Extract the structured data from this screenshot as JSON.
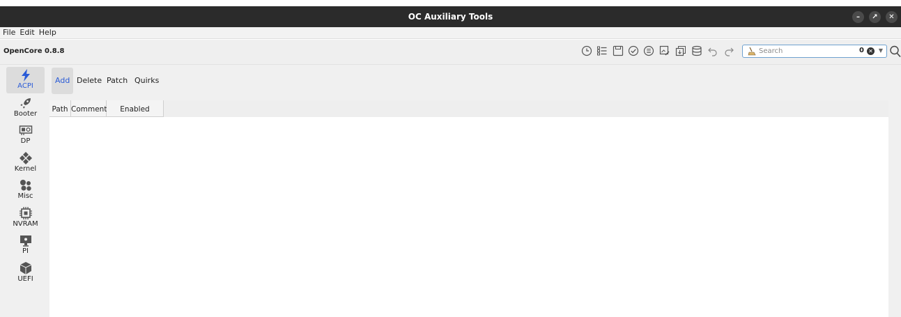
{
  "window": {
    "title": "OC Auxiliary Tools",
    "min_glyph": "–",
    "max_glyph": "↗",
    "close_glyph": "✕"
  },
  "menu": {
    "items": [
      "File",
      "Edit",
      "Help"
    ]
  },
  "toolbar": {
    "version": "OpenCore 0.8.8",
    "icons": [
      "clock-icon",
      "list-icon",
      "save-icon",
      "check-circle-icon",
      "list-circle-icon",
      "image-edit-icon",
      "import-icon",
      "database-icon",
      "undo-icon",
      "redo-icon"
    ],
    "search": {
      "placeholder": "Search",
      "count": "0",
      "clear_glyph": "✕",
      "dropdown_glyph": "▼"
    }
  },
  "sidebar": {
    "items": [
      {
        "label": "ACPI",
        "icon": "lightning-icon",
        "active": true
      },
      {
        "label": "Booter",
        "icon": "rocket-icon"
      },
      {
        "label": "DP",
        "icon": "graphics-card-icon"
      },
      {
        "label": "Kernel",
        "icon": "cubes-icon"
      },
      {
        "label": "Misc",
        "icon": "hexagons-icon"
      },
      {
        "label": "NVRAM",
        "icon": "chip-icon"
      },
      {
        "label": "PI",
        "icon": "monitor-icon"
      },
      {
        "label": "UEFI",
        "icon": "box-icon"
      }
    ]
  },
  "tabs": [
    {
      "label": "Add",
      "active": true
    },
    {
      "label": "Delete"
    },
    {
      "label": "Patch"
    },
    {
      "label": "Quirks"
    }
  ],
  "table": {
    "columns": [
      "Path",
      "Comment",
      "Enabled"
    ],
    "rows": []
  },
  "colors": {
    "accent": "#2a5bd7",
    "titlebar": "#2b2b2b"
  }
}
